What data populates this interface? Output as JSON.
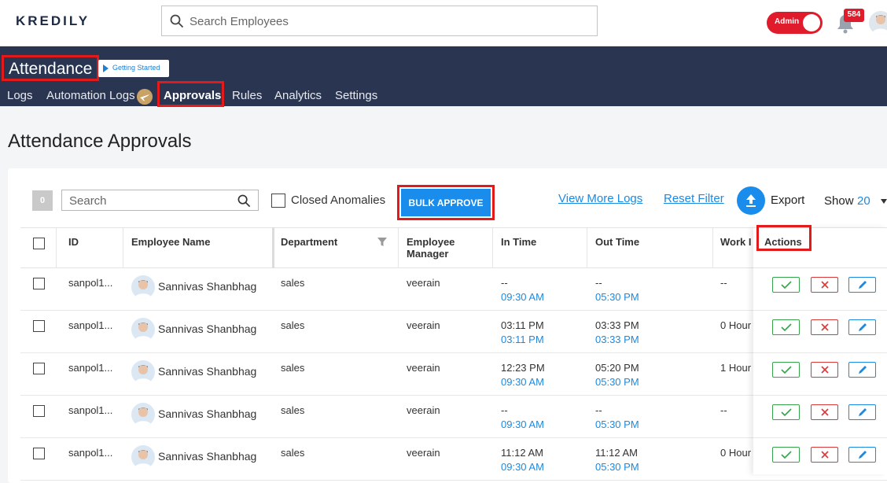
{
  "app": {
    "logo_text": "KREDILY",
    "search_placeholder": "Search Employees",
    "admin_label": "Admin",
    "notification_count": "584"
  },
  "header": {
    "title": "Attendance",
    "getting_started": "Getting Started",
    "tabs": [
      "Logs",
      "Automation Logs",
      "Approvals",
      "Rules",
      "Analytics",
      "Settings"
    ],
    "active_tab": "Approvals"
  },
  "main": {
    "title": "Attendance Approvals",
    "toolbar": {
      "selected_count": "0",
      "search_placeholder": "Search",
      "closed_anomalies": "Closed Anomalies",
      "bulk_approve": "BULK APPROVE",
      "view_more_logs": "View More Logs",
      "reset_filter": "Reset Filter",
      "export": "Export",
      "show_label": "Show",
      "show_value": "20"
    },
    "columns": [
      "ID",
      "Employee Name",
      "Department",
      "Employee Manager",
      "In Time",
      "Out Time",
      "Work I",
      "Actions"
    ],
    "rows": [
      {
        "id": "sanpol1...",
        "name": "Sannivas Shanbhag",
        "dept": "sales",
        "manager": "veerain",
        "in_time": "--",
        "in_sched": "09:30 AM",
        "out_time": "--",
        "out_sched": "05:30 PM",
        "work": "--"
      },
      {
        "id": "sanpol1...",
        "name": "Sannivas Shanbhag",
        "dept": "sales",
        "manager": "veerain",
        "in_time": "03:11 PM",
        "in_sched": "03:11 PM",
        "out_time": "03:33 PM",
        "out_sched": "03:33 PM",
        "work": "0 Hour"
      },
      {
        "id": "sanpol1...",
        "name": "Sannivas Shanbhag",
        "dept": "sales",
        "manager": "veerain",
        "in_time": "12:23 PM",
        "in_sched": "09:30 AM",
        "out_time": "05:20 PM",
        "out_sched": "05:30 PM",
        "work": "1 Hour"
      },
      {
        "id": "sanpol1...",
        "name": "Sannivas Shanbhag",
        "dept": "sales",
        "manager": "veerain",
        "in_time": "--",
        "in_sched": "09:30 AM",
        "out_time": "--",
        "out_sched": "05:30 PM",
        "work": "--"
      },
      {
        "id": "sanpol1...",
        "name": "Sannivas Shanbhag",
        "dept": "sales",
        "manager": "veerain",
        "in_time": "11:12 AM",
        "in_sched": "09:30 AM",
        "out_time": "11:12 AM",
        "out_sched": "05:30 PM",
        "work": "0 Hour"
      }
    ]
  },
  "colors": {
    "header_bg": "#2a3651",
    "accent": "#1a8cec",
    "highlight": "#e31a1a",
    "approve": "#37a34a",
    "reject": "#d83a3a"
  }
}
